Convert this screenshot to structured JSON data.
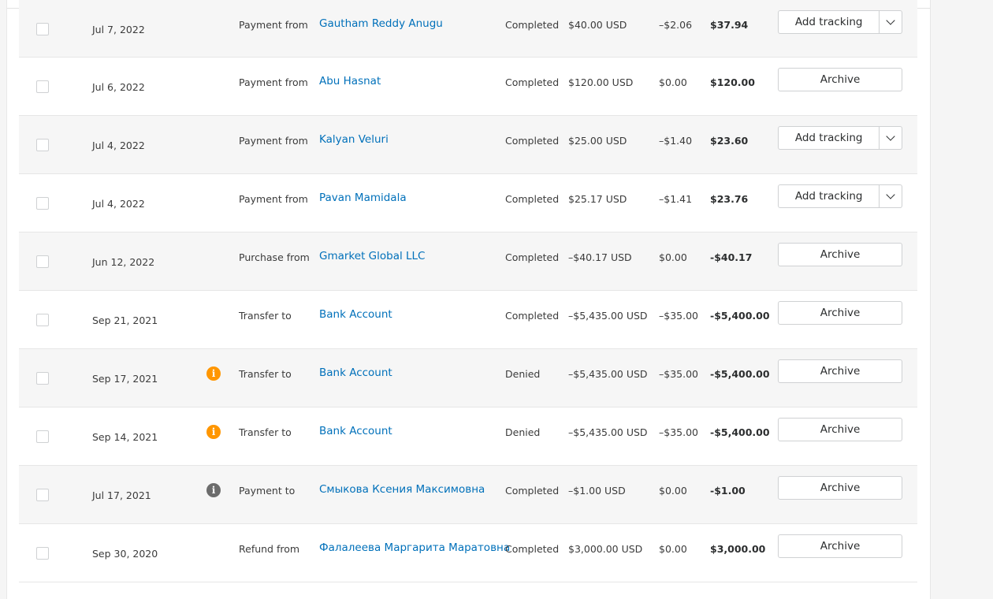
{
  "rows": [
    {
      "date": "Jul 7, 2022",
      "info": "",
      "type": "Payment from",
      "name": "Gautham Reddy Anugu",
      "status": "Completed",
      "gross": "$40.00 USD",
      "fee": "–$2.06",
      "net": "$37.94",
      "action": "Add tracking",
      "split": true
    },
    {
      "date": "Jul 6, 2022",
      "info": "",
      "type": "Payment from",
      "name": "Abu Hasnat",
      "status": "Completed",
      "gross": "$120.00 USD",
      "fee": "$0.00",
      "net": "$120.00",
      "action": "Archive",
      "split": false
    },
    {
      "date": "Jul 4, 2022",
      "info": "",
      "type": "Payment from",
      "name": "Kalyan Veluri",
      "status": "Completed",
      "gross": "$25.00 USD",
      "fee": "–$1.40",
      "net": "$23.60",
      "action": "Add tracking",
      "split": true
    },
    {
      "date": "Jul 4, 2022",
      "info": "",
      "type": "Payment from",
      "name": "Pavan Mamidala",
      "status": "Completed",
      "gross": "$25.17 USD",
      "fee": "–$1.41",
      "net": "$23.76",
      "action": "Add tracking",
      "split": true
    },
    {
      "date": "Jun 12, 2022",
      "info": "",
      "type": "Purchase from",
      "name": "Gmarket Global LLC",
      "status": "Completed",
      "gross": "–$40.17 USD",
      "fee": "$0.00",
      "net": "-$40.17",
      "action": "Archive",
      "split": false
    },
    {
      "date": "Sep 21, 2021",
      "info": "",
      "type": "Transfer to",
      "name": "Bank Account",
      "status": "Completed",
      "gross": "–$5,435.00 USD",
      "fee": "–$35.00",
      "net": "-$5,400.00",
      "action": "Archive",
      "split": false
    },
    {
      "date": "Sep 17, 2021",
      "info": "warn",
      "type": "Transfer to",
      "name": "Bank Account",
      "status": "Denied",
      "gross": "–$5,435.00 USD",
      "fee": "–$35.00",
      "net": "-$5,400.00",
      "action": "Archive",
      "split": false
    },
    {
      "date": "Sep 14, 2021",
      "info": "warn",
      "type": "Transfer to",
      "name": "Bank Account",
      "status": "Denied",
      "gross": "–$5,435.00 USD",
      "fee": "–$35.00",
      "net": "-$5,400.00",
      "action": "Archive",
      "split": false
    },
    {
      "date": "Jul 17, 2021",
      "info": "neutral",
      "type": "Payment to",
      "name": "Смыкова Ксения Максимовна",
      "status": "Completed",
      "gross": "–$1.00 USD",
      "fee": "$0.00",
      "net": "-$1.00",
      "action": "Archive",
      "split": false
    },
    {
      "date": "Sep 30, 2020",
      "info": "",
      "type": "Refund from",
      "name": "Фалалеева Маргарита Маратовна",
      "status": "Completed",
      "gross": "$3,000.00 USD",
      "fee": "$0.00",
      "net": "$3,000.00",
      "action": "Archive",
      "split": false
    }
  ],
  "info_glyph": "i",
  "icons": {
    "info": "info-icon",
    "caret": "chevron-down-icon"
  },
  "colors": {
    "link": "#0070ba",
    "warn": "#ff9600",
    "neutral": "#6c6c6c",
    "shade": "#f6f6f6"
  }
}
